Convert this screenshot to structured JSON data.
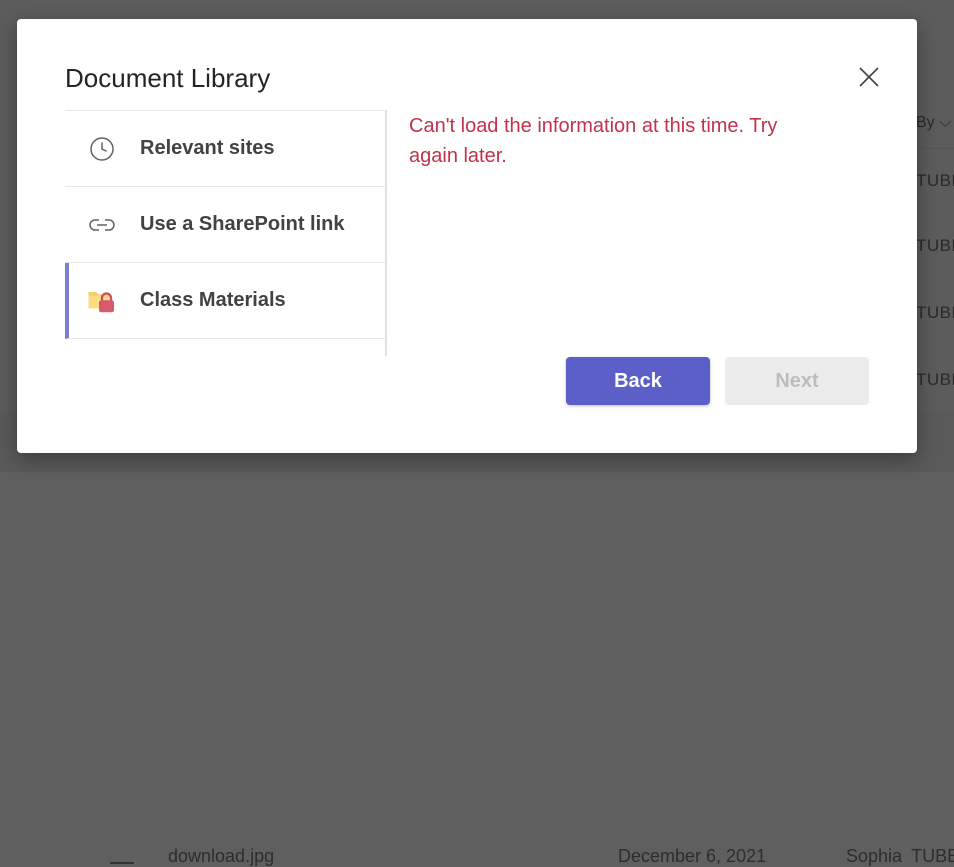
{
  "background": {
    "header_partial": "By",
    "cell_partial": "TUBE",
    "bottom_row": {
      "file_partial": "download.jpg",
      "date_partial": "December 6, 2021",
      "modified_by_partial": "Sophia"
    }
  },
  "dialog": {
    "title": "Document Library",
    "close_icon": "close-icon",
    "nav": [
      {
        "label": "Relevant sites",
        "icon": "clock-icon",
        "selected": false
      },
      {
        "label": "Use a SharePoint link",
        "icon": "link-icon",
        "selected": false
      },
      {
        "label": "Class Materials",
        "icon": "locked-folder-icon",
        "selected": true
      }
    ],
    "error_message": "Can't load the information at this time. Try again later.",
    "buttons": {
      "back": "Back",
      "next": "Next"
    }
  },
  "colors": {
    "accent": "#5b5fc7",
    "selected_indicator": "#7b80cc",
    "error": "#c4314b",
    "disabled_bg": "#ebebeb",
    "disabled_text": "#bdbdbd"
  }
}
